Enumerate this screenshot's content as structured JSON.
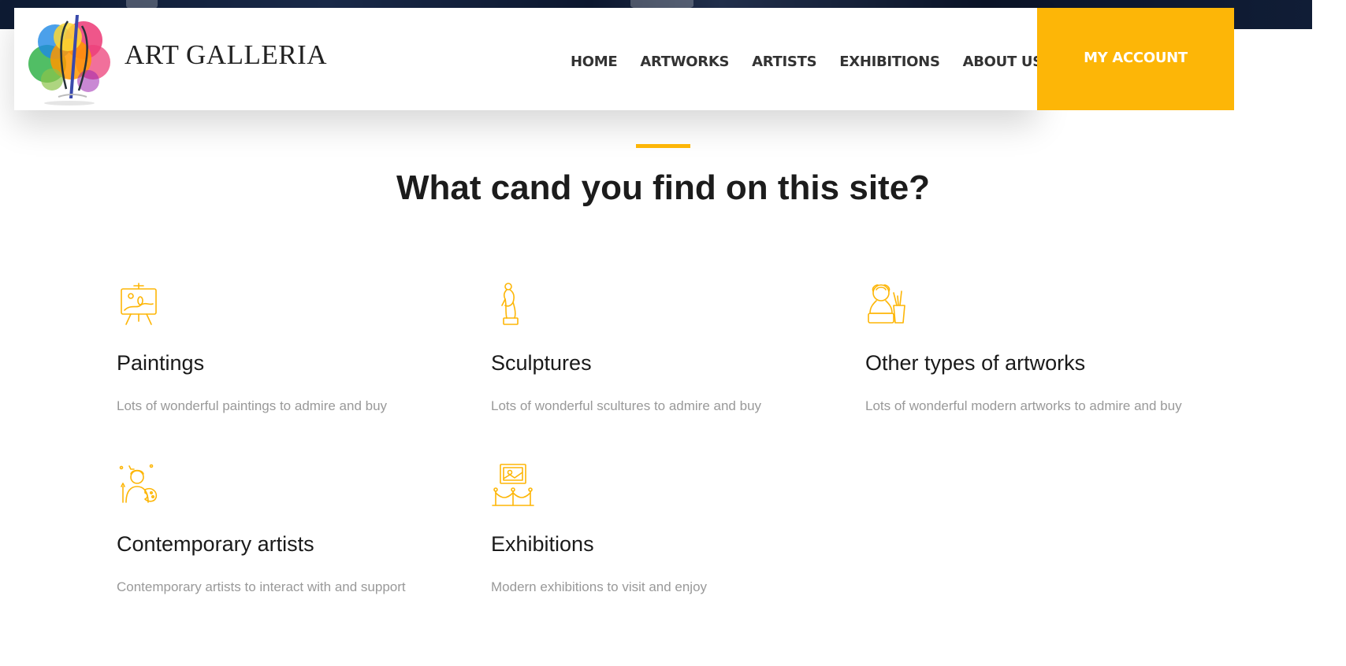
{
  "site": {
    "brand": "ART GALLERIA"
  },
  "nav": {
    "items": [
      {
        "label": "HOME"
      },
      {
        "label": "ARTWORKS"
      },
      {
        "label": "ARTISTS"
      },
      {
        "label": "EXHIBITIONS"
      },
      {
        "label": "ABOUT US"
      }
    ],
    "account_label": "MY ACCOUNT"
  },
  "section": {
    "title": "What cand you find on this site?"
  },
  "features": [
    {
      "icon": "easel-painting-icon",
      "title": "Paintings",
      "desc": "Lots of wonderful paintings to admire and buy"
    },
    {
      "icon": "statue-icon",
      "title": "Sculptures",
      "desc": "Lots of wonderful scultures to admire and buy"
    },
    {
      "icon": "bust-and-brushes-icon",
      "title": "Other types of artworks",
      "desc": "Lots of wonderful modern artworks to admire and buy"
    },
    {
      "icon": "artist-palette-icon",
      "title": "Contemporary artists",
      "desc": "Contemporary artists to interact with and support"
    },
    {
      "icon": "framed-exhibit-icon",
      "title": "Exhibitions",
      "desc": "Modern exhibitions to visit and enjoy"
    }
  ],
  "colors": {
    "accent": "#fdb607",
    "heading": "#1c1c1c",
    "muted": "#999999",
    "nav_text": "#333333"
  }
}
